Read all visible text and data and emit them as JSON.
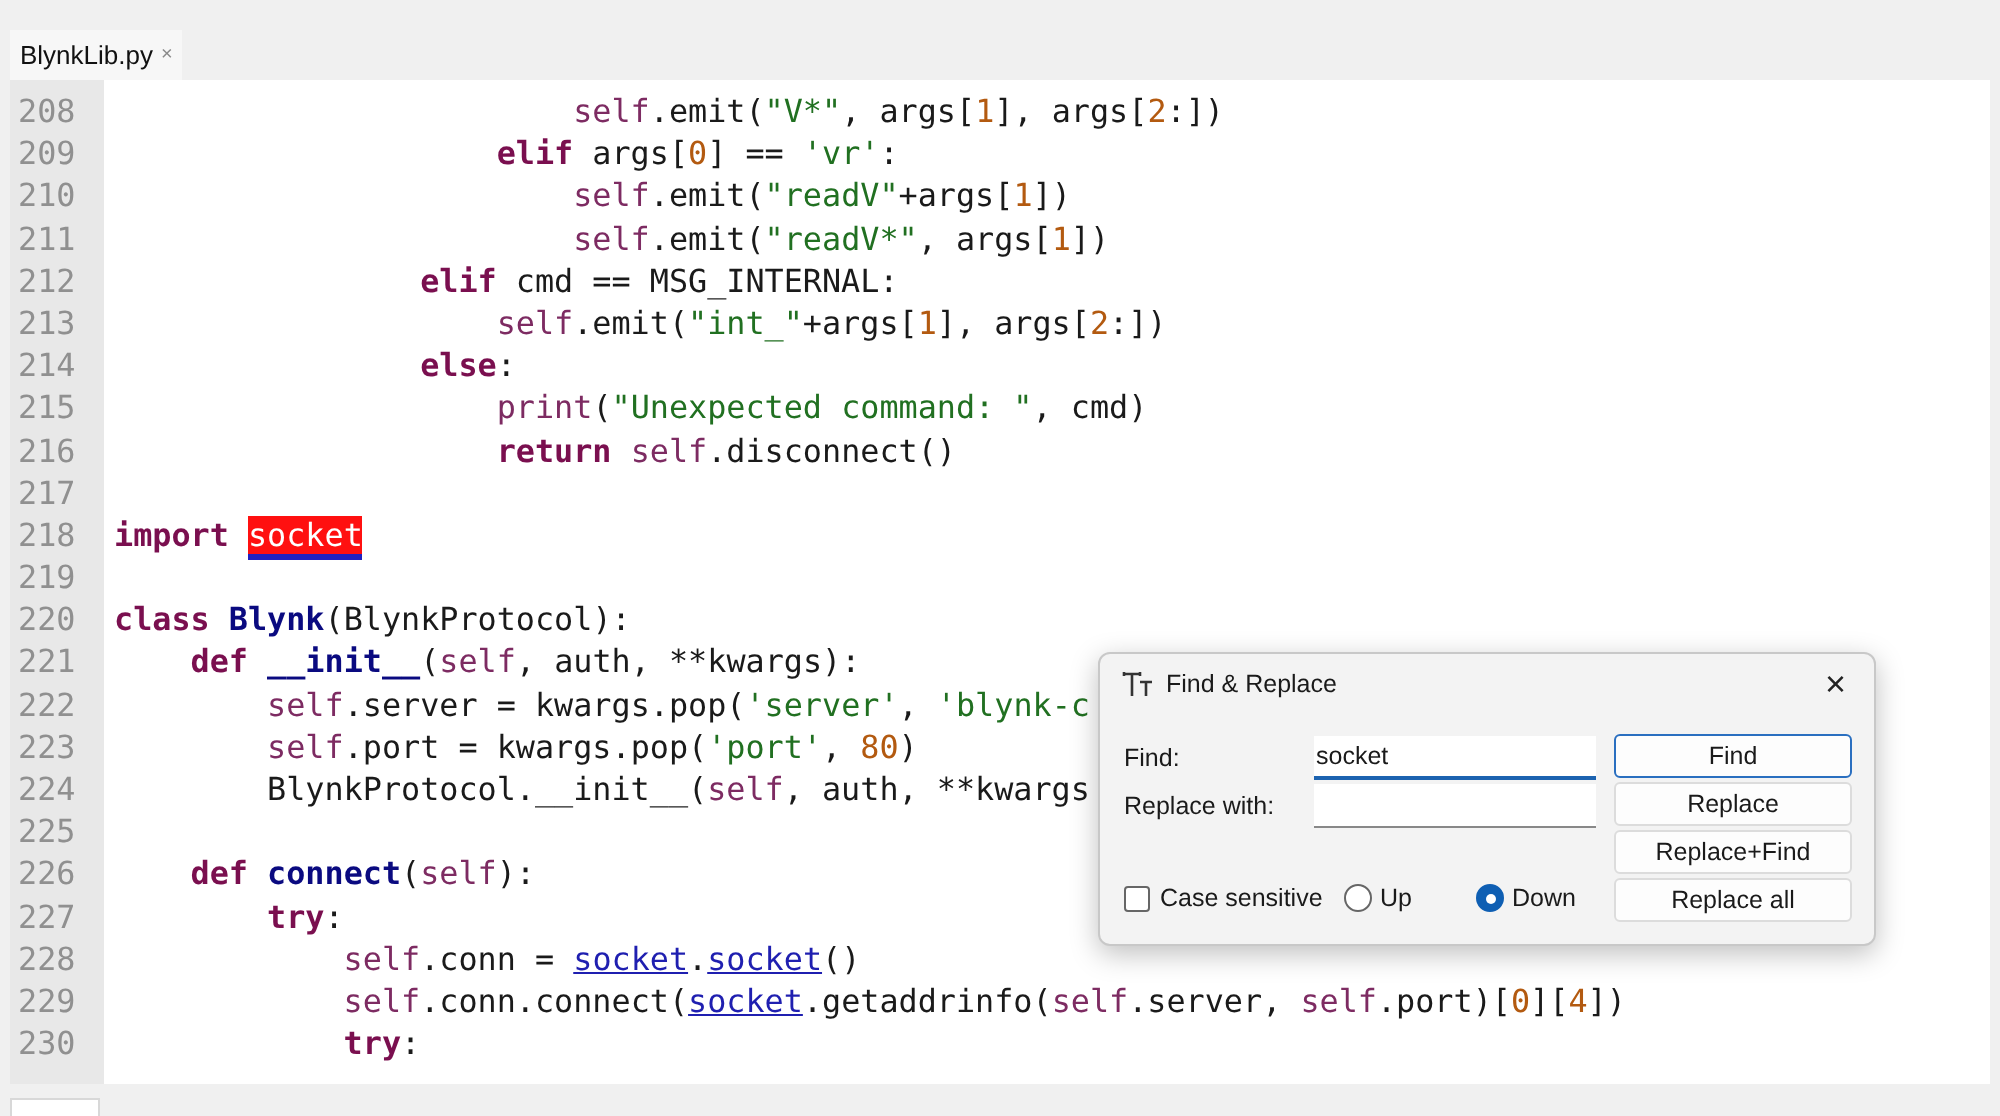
{
  "tabs": [
    {
      "label": "BlynkLib.py",
      "close": "×",
      "selected": true
    }
  ],
  "editor": {
    "lines": [
      {
        "number": "208",
        "tokens": [
          {
            "kind": "self",
            "text": "                        self"
          },
          {
            "kind": "plain",
            "text": ".emit("
          },
          {
            "kind": "string",
            "text": "\"V*\""
          },
          {
            "kind": "plain",
            "text": ", args["
          },
          {
            "kind": "number",
            "text": "1"
          },
          {
            "kind": "plain",
            "text": "], args["
          },
          {
            "kind": "number",
            "text": "2"
          },
          {
            "kind": "plain",
            "text": ":])"
          }
        ]
      },
      {
        "number": "209",
        "tokens": [
          {
            "kind": "keyword",
            "text": "                    elif"
          },
          {
            "kind": "plain",
            "text": " args["
          },
          {
            "kind": "number",
            "text": "0"
          },
          {
            "kind": "plain",
            "text": "] == "
          },
          {
            "kind": "string",
            "text": "'vr'"
          },
          {
            "kind": "plain",
            "text": ":"
          }
        ]
      },
      {
        "number": "210",
        "tokens": [
          {
            "kind": "self",
            "text": "                        self"
          },
          {
            "kind": "plain",
            "text": ".emit("
          },
          {
            "kind": "string",
            "text": "\"readV\""
          },
          {
            "kind": "plain",
            "text": "+args["
          },
          {
            "kind": "number",
            "text": "1"
          },
          {
            "kind": "plain",
            "text": "])"
          }
        ]
      },
      {
        "number": "211",
        "tokens": [
          {
            "kind": "self",
            "text": "                        self"
          },
          {
            "kind": "plain",
            "text": ".emit("
          },
          {
            "kind": "string",
            "text": "\"readV*\""
          },
          {
            "kind": "plain",
            "text": ", args["
          },
          {
            "kind": "number",
            "text": "1"
          },
          {
            "kind": "plain",
            "text": "])"
          }
        ]
      },
      {
        "number": "212",
        "tokens": [
          {
            "kind": "keyword",
            "text": "                elif"
          },
          {
            "kind": "plain",
            "text": " cmd == MSG_INTERNAL:"
          }
        ]
      },
      {
        "number": "213",
        "tokens": [
          {
            "kind": "self",
            "text": "                    self"
          },
          {
            "kind": "plain",
            "text": ".emit("
          },
          {
            "kind": "string",
            "text": "\"int_\""
          },
          {
            "kind": "plain",
            "text": "+args["
          },
          {
            "kind": "number",
            "text": "1"
          },
          {
            "kind": "plain",
            "text": "], args["
          },
          {
            "kind": "number",
            "text": "2"
          },
          {
            "kind": "plain",
            "text": ":])"
          }
        ]
      },
      {
        "number": "214",
        "tokens": [
          {
            "kind": "keyword",
            "text": "                else"
          },
          {
            "kind": "plain",
            "text": ":"
          }
        ]
      },
      {
        "number": "215",
        "tokens": [
          {
            "kind": "self",
            "text": "                    print"
          },
          {
            "kind": "plain",
            "text": "("
          },
          {
            "kind": "string",
            "text": "\"Unexpected command: \""
          },
          {
            "kind": "plain",
            "text": ", cmd)"
          }
        ]
      },
      {
        "number": "216",
        "tokens": [
          {
            "kind": "keyword",
            "text": "                    return"
          },
          {
            "kind": "self",
            "text": " self"
          },
          {
            "kind": "plain",
            "text": ".disconnect()"
          }
        ]
      },
      {
        "number": "217"
      },
      {
        "number": "218",
        "tokens": [
          {
            "kind": "keyword",
            "text": "import "
          },
          {
            "kind": "match",
            "text": "socket"
          }
        ]
      },
      {
        "number": "219"
      },
      {
        "number": "220",
        "tokens": [
          {
            "kind": "keyword",
            "text": "class"
          },
          {
            "kind": "definition",
            "text": " Blynk"
          },
          {
            "kind": "plain",
            "text": "(BlynkProtocol):"
          }
        ]
      },
      {
        "number": "221",
        "tokens": [
          {
            "kind": "keyword",
            "text": "    def"
          },
          {
            "kind": "definition",
            "text": " __init__"
          },
          {
            "kind": "plain",
            "text": "("
          },
          {
            "kind": "self",
            "text": "self"
          },
          {
            "kind": "plain",
            "text": ", auth, **kwargs):"
          }
        ]
      },
      {
        "number": "222",
        "tokens": [
          {
            "kind": "self",
            "text": "        self"
          },
          {
            "kind": "plain",
            "text": ".server = kwargs.pop("
          },
          {
            "kind": "string",
            "text": "'server'"
          },
          {
            "kind": "plain",
            "text": ", "
          },
          {
            "kind": "string",
            "text": "'blynk-c"
          }
        ]
      },
      {
        "number": "223",
        "tokens": [
          {
            "kind": "self",
            "text": "        self"
          },
          {
            "kind": "plain",
            "text": ".port = kwargs.pop("
          },
          {
            "kind": "string",
            "text": "'port'"
          },
          {
            "kind": "plain",
            "text": ", "
          },
          {
            "kind": "number",
            "text": "80"
          },
          {
            "kind": "plain",
            "text": ")"
          }
        ]
      },
      {
        "number": "224",
        "tokens": [
          {
            "kind": "plain",
            "text": "        BlynkProtocol.__init__("
          },
          {
            "kind": "self",
            "text": "self"
          },
          {
            "kind": "plain",
            "text": ", auth, **kwargs"
          }
        ]
      },
      {
        "number": "225"
      },
      {
        "number": "226",
        "tokens": [
          {
            "kind": "keyword",
            "text": "    def"
          },
          {
            "kind": "definition",
            "text": " connect"
          },
          {
            "kind": "plain",
            "text": "("
          },
          {
            "kind": "self",
            "text": "self"
          },
          {
            "kind": "plain",
            "text": "):"
          }
        ]
      },
      {
        "number": "227",
        "tokens": [
          {
            "kind": "keyword",
            "text": "        try"
          },
          {
            "kind": "plain",
            "text": ":"
          }
        ]
      },
      {
        "number": "228",
        "tokens": [
          {
            "kind": "self",
            "text": "            self"
          },
          {
            "kind": "plain",
            "text": ".conn = "
          },
          {
            "kind": "link",
            "text": "socket"
          },
          {
            "kind": "plain",
            "text": "."
          },
          {
            "kind": "link",
            "text": "socket"
          },
          {
            "kind": "plain",
            "text": "()"
          }
        ]
      },
      {
        "number": "229",
        "tokens": [
          {
            "kind": "self",
            "text": "            self"
          },
          {
            "kind": "plain",
            "text": ".conn.connect("
          },
          {
            "kind": "link",
            "text": "socket"
          },
          {
            "kind": "plain",
            "text": ".getaddrinfo("
          },
          {
            "kind": "self",
            "text": "self"
          },
          {
            "kind": "plain",
            "text": ".server, "
          },
          {
            "kind": "self",
            "text": "self"
          },
          {
            "kind": "plain",
            "text": ".port)["
          },
          {
            "kind": "number",
            "text": "0"
          },
          {
            "kind": "plain",
            "text": "]["
          },
          {
            "kind": "number",
            "text": "4"
          },
          {
            "kind": "plain",
            "text": "])"
          }
        ]
      },
      {
        "number": "230",
        "tokens": [
          {
            "kind": "keyword",
            "text": "            try"
          },
          {
            "kind": "plain",
            "text": ":"
          }
        ]
      }
    ]
  },
  "dialog": {
    "title": "Find & Replace",
    "close": "×",
    "find": {
      "label": "Find:",
      "value": "socket"
    },
    "replace": {
      "label": "Replace with:"
    },
    "case_sensitive": {
      "label": "Case sensitive",
      "checked": false
    },
    "direction": [
      {
        "label": "Up",
        "selected": false
      },
      {
        "label": "Down",
        "selected": true
      }
    ],
    "buttons": [
      {
        "label": "Find",
        "default": true
      },
      {
        "label": "Replace",
        "default": false
      },
      {
        "label": "Replace+Find",
        "default": false
      },
      {
        "label": "Replace all",
        "default": false
      }
    ]
  }
}
